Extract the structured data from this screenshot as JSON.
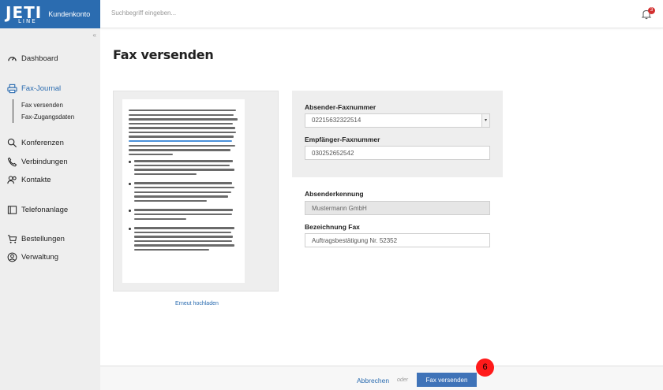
{
  "brand": {
    "logo": "JETI",
    "logo_sub": "LINE",
    "account": "Kundenkonto"
  },
  "search": {
    "placeholder": "Suchbegriff eingeben..."
  },
  "notifications": {
    "count": "3"
  },
  "nav": {
    "dashboard": "Dashboard",
    "fax_journal": "Fax-Journal",
    "fax_send": "Fax versenden",
    "fax_access": "Fax-Zugangsdaten",
    "conferences": "Konferenzen",
    "connections": "Verbindungen",
    "contacts": "Kontakte",
    "phone_system": "Telefonanlage",
    "orders": "Bestellungen",
    "admin": "Verwaltung"
  },
  "page": {
    "title": "Fax versenden",
    "reupload": "Erneut hochladen"
  },
  "form": {
    "sender_fax_label": "Absender-Faxnummer",
    "sender_fax_value": "02215632322514",
    "recipient_fax_label": "Empfänger-Faxnummer",
    "recipient_fax_value": "030252652542",
    "sender_id_label": "Absenderkennung",
    "sender_id_value": "Mustermann GmbH",
    "fax_name_label": "Bezeichnung Fax",
    "fax_name_value": "Auftragsbestätigung Nr. 52352"
  },
  "footer": {
    "cancel": "Abbrechen",
    "or": "oder",
    "send": "Fax versenden"
  },
  "step_marker": "6",
  "colors": {
    "brand": "#2b6cb0",
    "primary_button": "#3f73b8",
    "badge": "#d32f2f",
    "marker": "#ff1a1a"
  }
}
